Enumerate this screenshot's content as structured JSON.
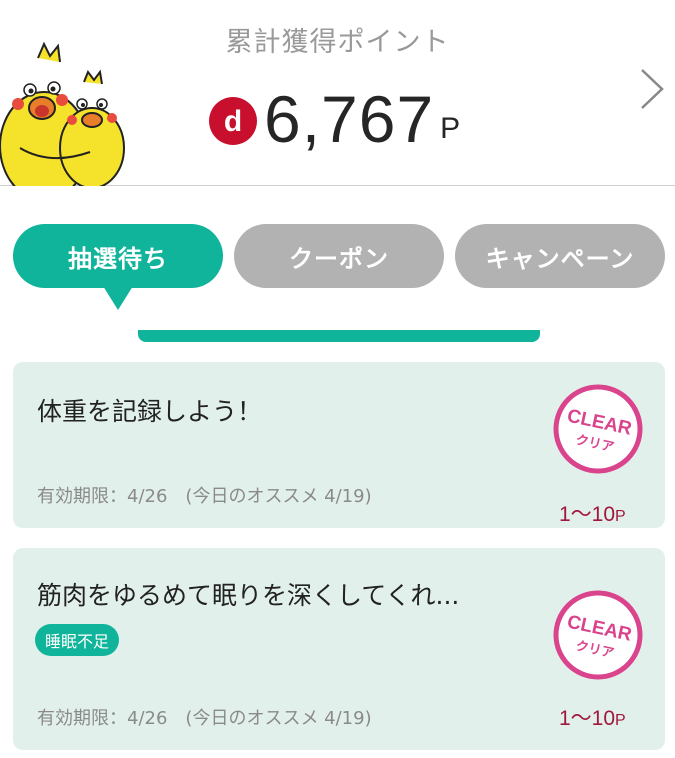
{
  "header": {
    "label": "累計獲得ポイント",
    "points": "6,767",
    "points_unit": "P",
    "d_logo": "d"
  },
  "tabs": [
    {
      "label": "抽選待ち",
      "active": true
    },
    {
      "label": "クーポン",
      "active": false
    },
    {
      "label": "キャンペーン",
      "active": false
    }
  ],
  "missions": [
    {
      "title": "体重を記録しよう！",
      "expiry": "有効期限：4/26　(今日のオススメ 4/19)",
      "points": "1〜10",
      "points_unit": "P",
      "badge_top": "CLEAR",
      "badge_bottom": "クリア"
    },
    {
      "title": "筋肉をゆるめて眠りを深くしてくれ...",
      "tag": "睡眠不足",
      "expiry": "有効期限：4/26　(今日のオススメ 4/19)",
      "points": "1〜10",
      "points_unit": "P",
      "badge_top": "CLEAR",
      "badge_bottom": "クリア"
    }
  ],
  "colors": {
    "accent": "#10b49a",
    "inactive_tab": "#b2b2b2",
    "card_bg": "#e2f0ec",
    "badge": "#d9448c",
    "points_text": "#a2173c",
    "d_logo": "#c8102e"
  },
  "icons": {
    "mascot": "poinco-mascot-icon",
    "chevron": "chevron-right-icon",
    "badge": "clear-stamp-icon"
  }
}
